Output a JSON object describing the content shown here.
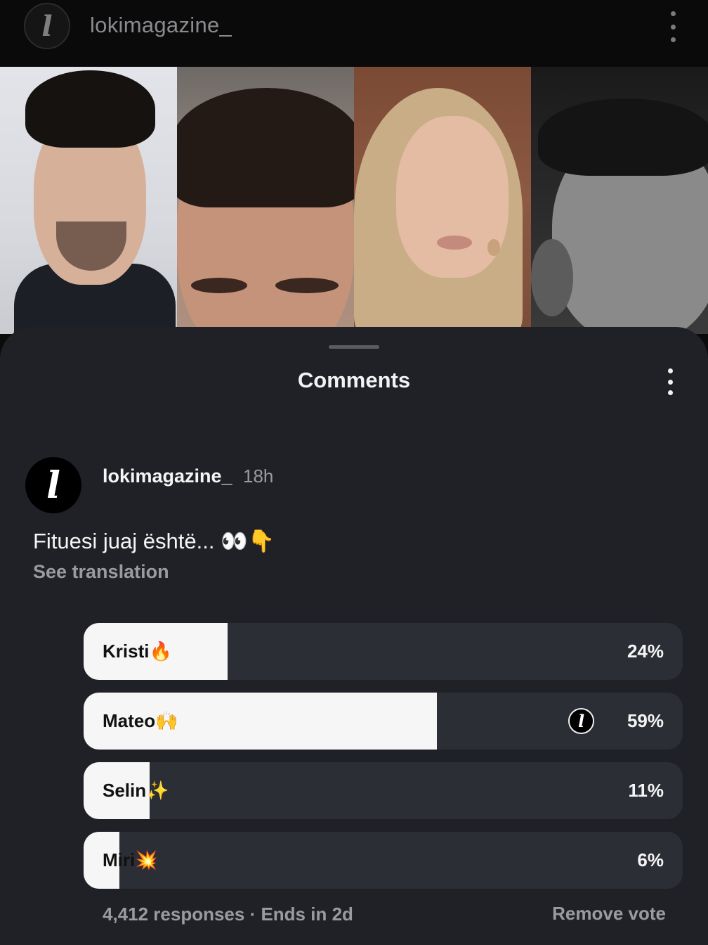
{
  "header": {
    "username": "lokimagazine_",
    "avatar_letter": "l"
  },
  "sheet": {
    "title": "Comments"
  },
  "comment": {
    "username": "lokimagazine_",
    "time": "18h",
    "text": "Fituesi juaj është... 👀👇",
    "see_translation": "See translation",
    "avatar_letter": "l"
  },
  "poll": {
    "options": [
      {
        "label": "Kristi🔥",
        "percent_text": "24%",
        "percent": 24
      },
      {
        "label": "Mateo🙌",
        "percent_text": "59%",
        "percent": 59,
        "voted": true
      },
      {
        "label": "Selin✨",
        "percent_text": "11%",
        "percent": 11
      },
      {
        "label": "Miri💥",
        "percent_text": "6%",
        "percent": 6
      }
    ],
    "meta": "4,412 responses · Ends in 2d",
    "remove_vote": "Remove vote"
  },
  "colors": {
    "sheet_bg": "#202127",
    "bar_bg": "#2c2e35",
    "bar_fill": "#f6f6f7",
    "muted_text": "#9a9ba1"
  }
}
